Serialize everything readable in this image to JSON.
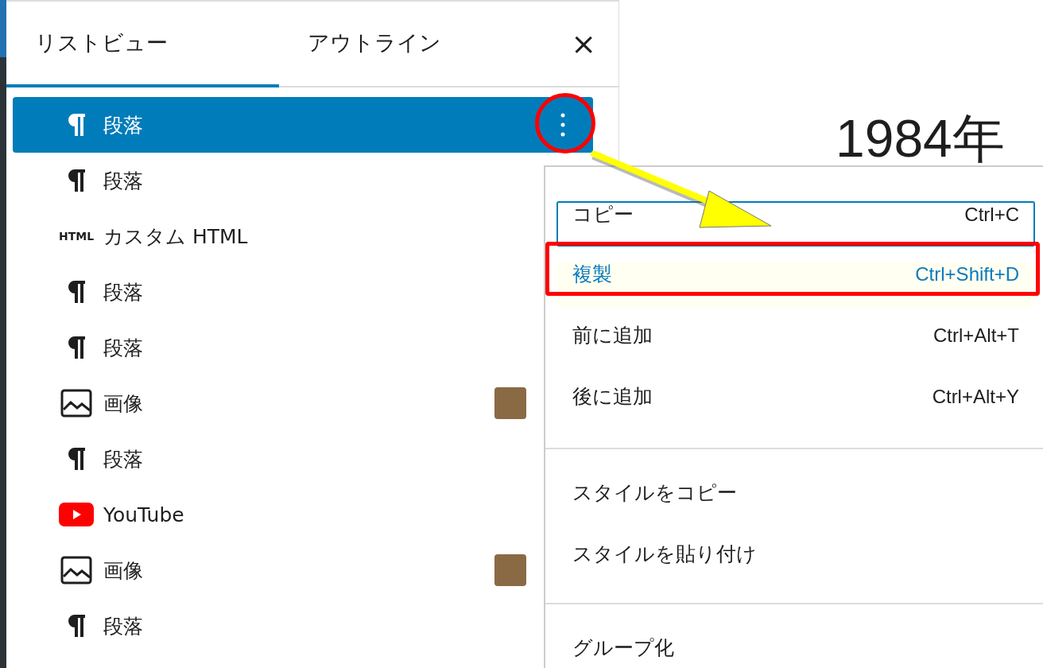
{
  "panel": {
    "tabs": [
      {
        "label": "リストビュー",
        "selected": true
      },
      {
        "label": "アウトライン",
        "selected": false
      }
    ],
    "close": "×"
  },
  "blocks": [
    {
      "kind": "paragraph",
      "label": "段落",
      "selected": true,
      "thumbnail": false
    },
    {
      "kind": "paragraph",
      "label": "段落",
      "selected": false,
      "thumbnail": false
    },
    {
      "kind": "html",
      "icon_label": "HTML",
      "label": "カスタム HTML",
      "selected": false,
      "thumbnail": false
    },
    {
      "kind": "paragraph",
      "label": "段落",
      "selected": false,
      "thumbnail": false
    },
    {
      "kind": "paragraph",
      "label": "段落",
      "selected": false,
      "thumbnail": false
    },
    {
      "kind": "image",
      "label": "画像",
      "selected": false,
      "thumbnail": true
    },
    {
      "kind": "paragraph",
      "label": "段落",
      "selected": false,
      "thumbnail": false
    },
    {
      "kind": "youtube",
      "label": "YouTube",
      "selected": false,
      "thumbnail": false
    },
    {
      "kind": "image",
      "label": "画像",
      "selected": false,
      "thumbnail": true
    },
    {
      "kind": "paragraph",
      "label": "段落",
      "selected": false,
      "thumbnail": false
    }
  ],
  "editor": {
    "heading": "1984年"
  },
  "menu": {
    "groups": [
      [
        {
          "label": "コピー",
          "shortcut": "Ctrl+C",
          "focused": true,
          "highlighted": false
        },
        {
          "label": "複製",
          "shortcut": "Ctrl+Shift+D",
          "focused": false,
          "highlighted": true
        },
        {
          "label": "前に追加",
          "shortcut": "Ctrl+Alt+T",
          "focused": false,
          "highlighted": false
        },
        {
          "label": "後に追加",
          "shortcut": "Ctrl+Alt+Y",
          "focused": false,
          "highlighted": false
        }
      ],
      [
        {
          "label": "スタイルをコピー",
          "focused": false,
          "highlighted": false
        },
        {
          "label": "スタイルを貼り付け",
          "focused": false,
          "highlighted": false
        }
      ],
      [
        {
          "label": "グループ化",
          "focused": false,
          "highlighted": false
        }
      ]
    ]
  }
}
